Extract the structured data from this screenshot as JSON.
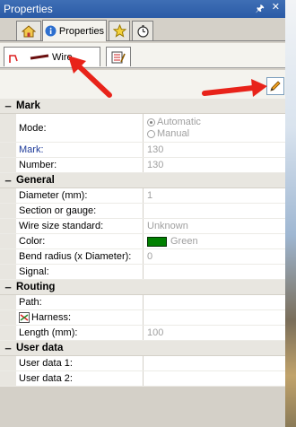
{
  "window": {
    "title": "Properties",
    "pin_glyph": " ¶",
    "close_glyph": "✕"
  },
  "tabs": [
    {
      "label": "",
      "icon": "home-icon"
    },
    {
      "label": "Properties",
      "icon": "info-icon"
    },
    {
      "label": "",
      "icon": "star-icon"
    },
    {
      "label": "",
      "icon": "stopwatch-icon"
    }
  ],
  "subtabs": [
    {
      "label": "Wire",
      "icon": "wire-icon"
    },
    {
      "label": "",
      "icon": "edit-list-icon"
    }
  ],
  "sections": {
    "mark": {
      "title": "Mark",
      "mode_label": "Mode:",
      "mode_options": [
        "Automatic",
        "Manual"
      ],
      "mode_selected": "Automatic",
      "mark_label": "Mark:",
      "mark_value": "130",
      "number_label": "Number:",
      "number_value": "130"
    },
    "general": {
      "title": "General",
      "diameter_label": "Diameter (mm):",
      "diameter_value": "1",
      "section_label": "Section or gauge:",
      "section_value": "",
      "wire_std_label": "Wire size standard:",
      "wire_std_value": "Unknown",
      "color_label": "Color:",
      "color_value": "Green",
      "color_hex": "#008000",
      "bend_label": "Bend radius (x Diameter):",
      "bend_value": "0",
      "signal_label": "Signal:",
      "signal_value": ""
    },
    "routing": {
      "title": "Routing",
      "path_label": "Path:",
      "path_value": "",
      "harness_label": "Harness:",
      "harness_value": "",
      "length_label": "Length (mm):",
      "length_value": "100"
    },
    "user": {
      "title": "User data",
      "user1_label": "User data 1:",
      "user1_value": "",
      "user2_label": "User data 2:",
      "user2_value": ""
    }
  },
  "toggle_glyph": "−",
  "colors": {
    "accent_arrow": "#e8231a",
    "titlebar": "#2b5ba6"
  }
}
